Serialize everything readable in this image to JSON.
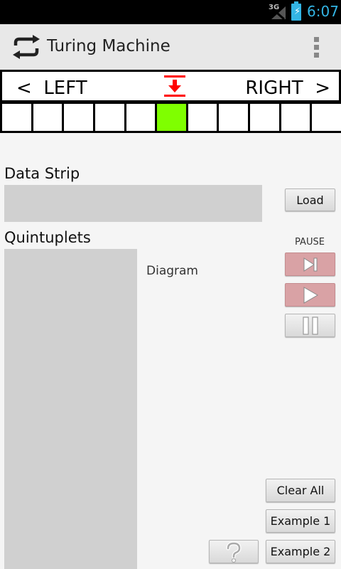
{
  "status_bar": {
    "network": "3G",
    "time": "6:07",
    "accent": "#33b5e5"
  },
  "action_bar": {
    "title": "Turing Machine",
    "icon": "repeat-icon",
    "menu_icon": "overflow-menu-icon"
  },
  "tape": {
    "left_label": "<  LEFT",
    "right_label": "RIGHT  >",
    "head_icon": "down-arrow-icon",
    "head_color": "#ff0000",
    "cell_count": 11,
    "active_cell": 5,
    "active_color": "#7fff00"
  },
  "data_strip": {
    "label": "Data Strip",
    "value": "",
    "load_label": "Load"
  },
  "quintuplets": {
    "label": "Quintuplets",
    "value": ""
  },
  "diagram": {
    "label": "Diagram"
  },
  "controls": {
    "state_label": "PAUSE",
    "step_icon": "step-forward-icon",
    "play_icon": "play-icon",
    "pause_icon": "pause-icon",
    "clear_all_label": "Clear All",
    "example1_label": "Example 1",
    "example2_label": "Example 2",
    "help_icon": "question-icon"
  }
}
